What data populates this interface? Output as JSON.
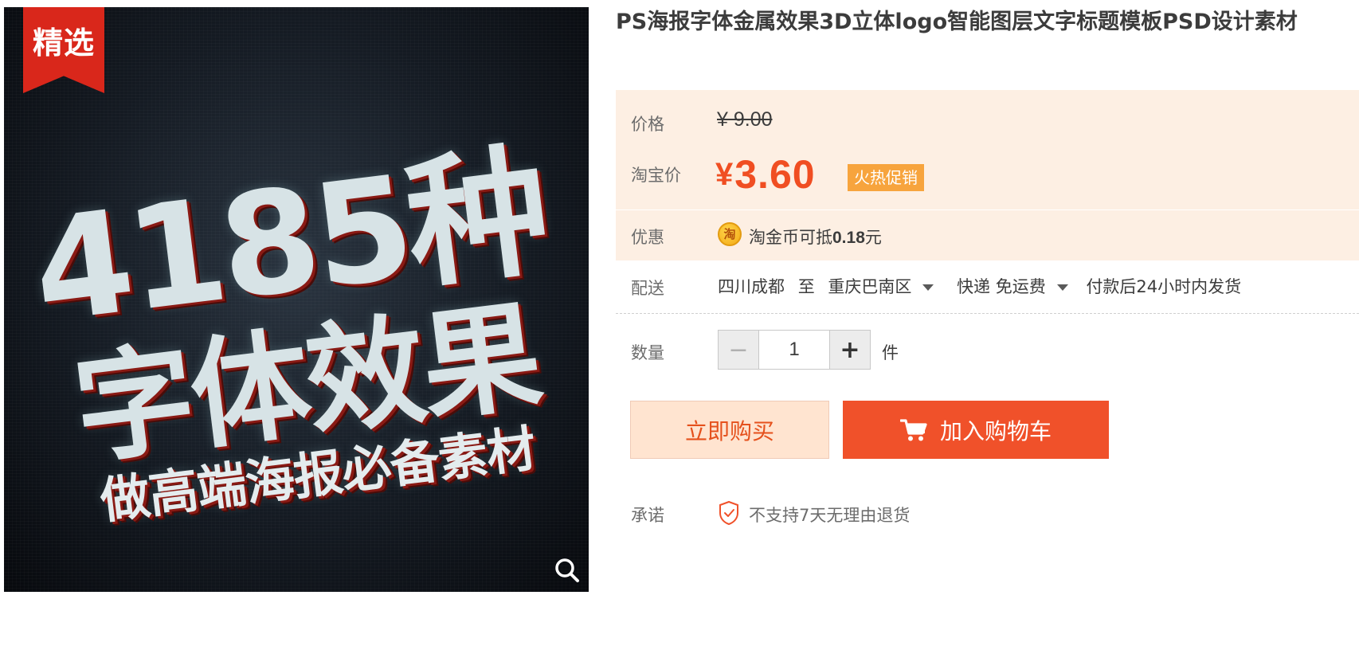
{
  "gallery": {
    "badge": "精选",
    "headline_line1": "4185种",
    "headline_line2": "字体效果",
    "headline_line3": "做高端海报必备素材",
    "zoom_icon": "search-icon"
  },
  "product": {
    "title": "PS海报字体金属效果3D立体logo智能图层文字标题模板PSD设计素材"
  },
  "price": {
    "label": "价格",
    "original": "¥ 9.00",
    "tb_label": "淘宝价",
    "currency": "¥",
    "tb_price": "3.60",
    "promo_tag": "火热促销"
  },
  "discount": {
    "label": "优惠",
    "coin_icon_glyph": "淘",
    "text_prefix": "淘金币可抵",
    "amount": "0.18",
    "text_suffix": "元"
  },
  "shipping": {
    "label": "配送",
    "from": "四川成都",
    "to_word": "至",
    "destination": "重庆巴南区",
    "method": "快递 免运费",
    "dispatch": "付款后24小时内发货"
  },
  "quantity": {
    "label": "数量",
    "minus": "−",
    "value": "1",
    "plus": "+",
    "unit": "件"
  },
  "actions": {
    "buy_now": "立即购买",
    "add_to_cart": "加入购物车"
  },
  "promise": {
    "label": "承诺",
    "text": "不支持7天无理由退货"
  },
  "colors": {
    "accent": "#f04e22",
    "price_bg": "#fdefe3",
    "promo_tag_bg": "#f7a43d",
    "ribbon": "#d9271b"
  }
}
